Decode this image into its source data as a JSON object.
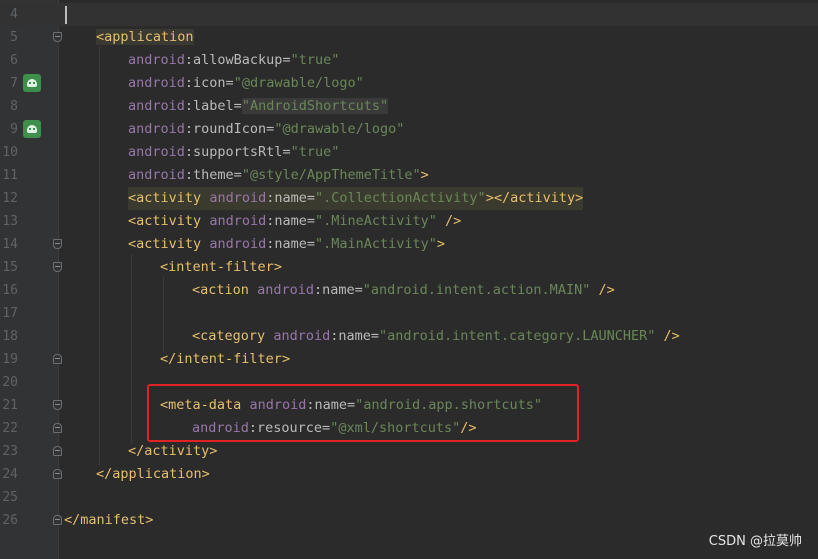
{
  "editor": {
    "watermark": "CSDN @拉莫帅",
    "lines": [
      {
        "n": "4"
      },
      {
        "n": "5",
        "open": "<",
        "tag": "application",
        "close": ""
      },
      {
        "n": "6",
        "ns": "android",
        "attr": ":allowBackup=",
        "val": "\"true\""
      },
      {
        "n": "7",
        "ns": "android",
        "attr": ":icon=",
        "val": "\"@drawable/logo\""
      },
      {
        "n": "8",
        "ns": "android",
        "attr": ":label=",
        "val": "\"AndroidShortcuts\""
      },
      {
        "n": "9",
        "ns": "android",
        "attr": ":roundIcon=",
        "val": "\"@drawable/logo\""
      },
      {
        "n": "10",
        "ns": "android",
        "attr": ":supportsRtl=",
        "val": "\"true\""
      },
      {
        "n": "11",
        "ns": "android",
        "attr": ":theme=",
        "val": "\"@style/AppThemeTitle\"",
        "close": ">"
      },
      {
        "n": "12",
        "open": "<",
        "tag": "activity",
        "ns": "android",
        "attr": ":name=",
        "val": "\".CollectionActivity\"",
        "close": "></",
        "tag2": "activity",
        "close2": ">"
      },
      {
        "n": "13",
        "open": "<",
        "tag": "activity",
        "ns": "android",
        "attr": ":name=",
        "val": "\".MineActivity\"",
        "close": " />"
      },
      {
        "n": "14",
        "open": "<",
        "tag": "activity",
        "ns": "android",
        "attr": ":name=",
        "val": "\".MainActivity\"",
        "close": ">"
      },
      {
        "n": "15",
        "open": "<",
        "tag": "intent-filter",
        "close": ">"
      },
      {
        "n": "16",
        "open": "<",
        "tag": "action",
        "ns": "android",
        "attr": ":name=",
        "val": "\"android.intent.action.MAIN\"",
        "close": " />"
      },
      {
        "n": "17"
      },
      {
        "n": "18",
        "open": "<",
        "tag": "category",
        "ns": "android",
        "attr": ":name=",
        "val": "\"android.intent.category.LAUNCHER\"",
        "close": " />"
      },
      {
        "n": "19",
        "open": "</",
        "tag": "intent-filter",
        "close": ">"
      },
      {
        "n": "20"
      },
      {
        "n": "21",
        "open": "<",
        "tag": "meta-data",
        "ns": "android",
        "attr": ":name=",
        "val": "\"android.app.shortcuts\"",
        "close": ""
      },
      {
        "n": "22",
        "ns": "android",
        "attr": ":resource=",
        "val": "\"@xml/shortcuts\"",
        "close": "/>"
      },
      {
        "n": "23",
        "open": "</",
        "tag": "activity",
        "close": ">"
      },
      {
        "n": "24",
        "open": "</",
        "tag": "application",
        "close": ">"
      },
      {
        "n": "25"
      },
      {
        "n": "26",
        "open": "</",
        "tag": "manifest",
        "close": ">"
      }
    ]
  }
}
